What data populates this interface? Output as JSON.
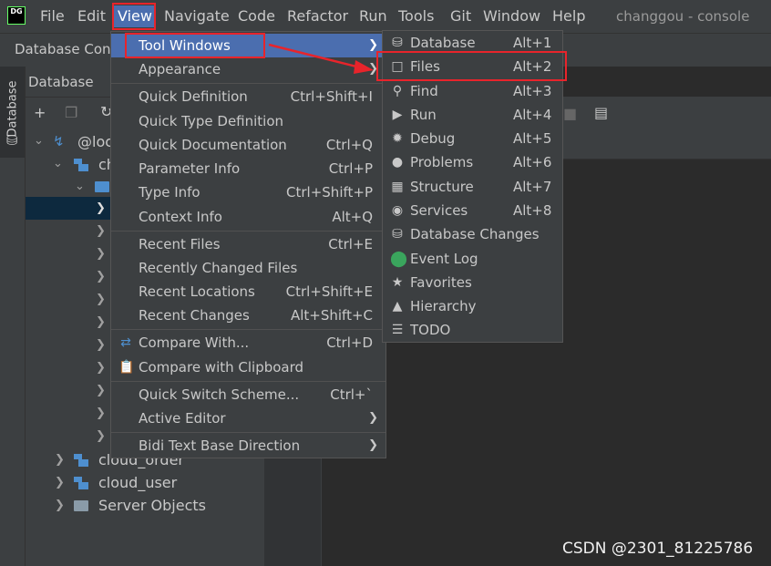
{
  "app": {
    "logo": "DG",
    "title": "changgou - console",
    "menubar": [
      "File",
      "Edit",
      "View",
      "Navigate",
      "Code",
      "Refactor",
      "Run",
      "Tools",
      "Git",
      "Window",
      "Help"
    ]
  },
  "toolbar": {
    "console_tab": "Database Cons"
  },
  "left_strip": {
    "database_tab": "Database"
  },
  "db_panel": {
    "title": "Database",
    "root_label": "@loc",
    "schema_label": "ch",
    "tree_items": [
      "cloud_order",
      "cloud_user",
      "Server Objects"
    ]
  },
  "view_menu": {
    "groups": [
      [
        {
          "label": "Tool Windows",
          "shortcut": "",
          "submenu": true,
          "highlighted": true
        },
        {
          "label": "Appearance",
          "shortcut": "",
          "submenu": true
        }
      ],
      [
        {
          "label": "Quick Definition",
          "shortcut": "Ctrl+Shift+I"
        },
        {
          "label": "Quick Type Definition",
          "shortcut": ""
        },
        {
          "label": "Quick Documentation",
          "shortcut": "Ctrl+Q"
        },
        {
          "label": "Parameter Info",
          "shortcut": "Ctrl+P"
        },
        {
          "label": "Type Info",
          "shortcut": "Ctrl+Shift+P"
        },
        {
          "label": "Context Info",
          "shortcut": "Alt+Q"
        }
      ],
      [
        {
          "label": "Recent Files",
          "shortcut": "Ctrl+E"
        },
        {
          "label": "Recently Changed Files",
          "shortcut": ""
        },
        {
          "label": "Recent Locations",
          "shortcut": "Ctrl+Shift+E"
        },
        {
          "label": "Recent Changes",
          "shortcut": "Alt+Shift+C"
        }
      ],
      [
        {
          "label": "Compare With...",
          "shortcut": "Ctrl+D",
          "icon": "compare-icon"
        },
        {
          "label": "Compare with Clipboard",
          "shortcut": "",
          "icon": "clipboard-compare-icon"
        }
      ],
      [
        {
          "label": "Quick Switch Scheme...",
          "shortcut": "Ctrl+`"
        },
        {
          "label": "Active Editor",
          "shortcut": "",
          "submenu": true
        }
      ],
      [
        {
          "label": "Bidi Text Base Direction",
          "shortcut": "",
          "submenu": true
        }
      ]
    ]
  },
  "tool_windows_menu": {
    "items": [
      {
        "label": "Database",
        "shortcut": "Alt+1",
        "icon": "database-icon"
      },
      {
        "label": "Files",
        "shortcut": "Alt+2",
        "icon": "folder-icon",
        "annotated": true
      },
      {
        "label": "Find",
        "shortcut": "Alt+3",
        "icon": "search-icon"
      },
      {
        "label": "Run",
        "shortcut": "Alt+4",
        "icon": "play-icon"
      },
      {
        "label": "Debug",
        "shortcut": "Alt+5",
        "icon": "bug-icon"
      },
      {
        "label": "Problems",
        "shortcut": "Alt+6",
        "icon": "warning-icon"
      },
      {
        "label": "Structure",
        "shortcut": "Alt+7",
        "icon": "structure-icon"
      },
      {
        "label": "Services",
        "shortcut": "Alt+8",
        "icon": "services-icon"
      },
      {
        "label": "Database Changes",
        "shortcut": "",
        "icon": "database-changes-icon"
      },
      {
        "label": "Event Log",
        "shortcut": "",
        "icon": "event-log-icon"
      },
      {
        "label": "Favorites",
        "shortcut": "",
        "icon": "star-icon"
      },
      {
        "label": "Hierarchy",
        "shortcut": "",
        "icon": "hierarchy-icon"
      },
      {
        "label": "TODO",
        "shortcut": "",
        "icon": "todo-icon"
      }
    ]
  },
  "watermark": "CSDN @2301_81225786",
  "colors": {
    "highlight": "#4b6eaf",
    "annotation": "#e8242b",
    "menu_bg": "#3c3f41"
  }
}
